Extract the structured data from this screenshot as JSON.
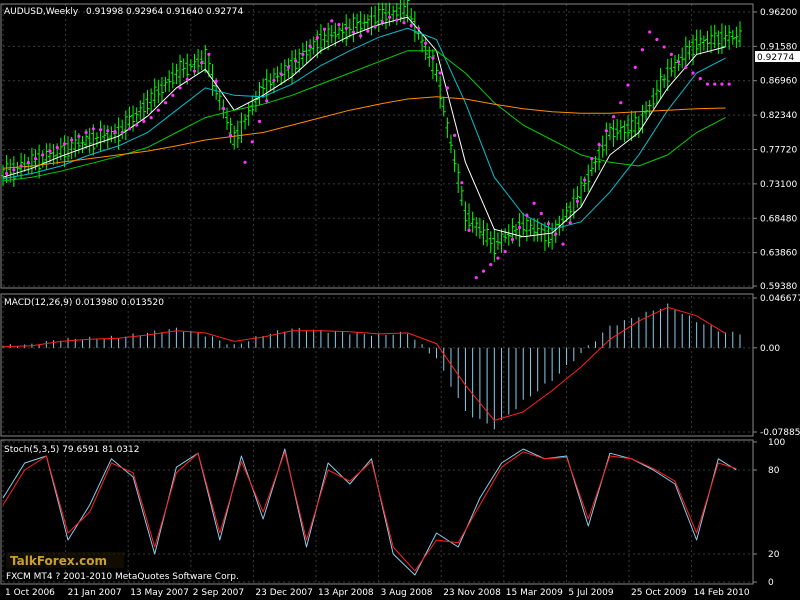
{
  "chart_data": [
    {
      "type": "line",
      "panel": "price",
      "title": "AUDUSD,Weekly",
      "ohlc_header": [
        "0.91998",
        "0.92964",
        "0.91640",
        "0.92774"
      ],
      "current_price": "0.92774",
      "ylim": [
        0.5938,
        0.97
      ],
      "y_ticks": [
        "0.96200",
        "0.91580",
        "0.86960",
        "0.82340",
        "0.77720",
        "0.73100",
        "0.68480",
        "0.63860",
        "0.59380"
      ],
      "x_ticks": [
        "1 Oct 2006",
        "21 Jan 2007",
        "13 May 2007",
        "2 Sep 2007",
        "23 Dec 2007",
        "13 Apr 2008",
        "3 Aug 2008",
        "23 Nov 2008",
        "15 Mar 2009",
        "5 Jul 2009",
        "25 Oct 2009",
        "14 Feb 2010"
      ],
      "grid": true,
      "x_index": [
        0,
        8,
        16,
        24,
        32,
        40,
        48,
        56,
        64,
        72,
        80,
        88,
        96,
        104,
        112,
        120,
        128,
        136,
        144,
        152,
        160,
        168,
        176,
        184,
        192,
        200
      ],
      "series": [
        {
          "role": "close",
          "color": "#00ff00",
          "values": [
            0.745,
            0.76,
            0.775,
            0.79,
            0.8,
            0.84,
            0.88,
            0.9,
            0.79,
            0.86,
            0.89,
            0.925,
            0.94,
            0.955,
            0.965,
            0.88,
            0.69,
            0.65,
            0.675,
            0.66,
            0.72,
            0.8,
            0.81,
            0.88,
            0.92,
            0.928
          ]
        },
        {
          "role": "fast-ma",
          "color": "#ffffff",
          "values": [
            0.74,
            0.752,
            0.768,
            0.782,
            0.795,
            0.822,
            0.86,
            0.885,
            0.83,
            0.85,
            0.875,
            0.91,
            0.93,
            0.945,
            0.955,
            0.91,
            0.76,
            0.67,
            0.66,
            0.665,
            0.7,
            0.77,
            0.8,
            0.86,
            0.905,
            0.915
          ]
        },
        {
          "role": "mid-ma",
          "color": "#00c0d0",
          "values": [
            0.738,
            0.745,
            0.755,
            0.77,
            0.782,
            0.8,
            0.83,
            0.86,
            0.85,
            0.848,
            0.865,
            0.89,
            0.91,
            0.928,
            0.94,
            0.925,
            0.84,
            0.74,
            0.69,
            0.67,
            0.68,
            0.72,
            0.77,
            0.83,
            0.88,
            0.9
          ]
        },
        {
          "role": "slow-ma",
          "color": "#00d000",
          "values": [
            0.735,
            0.74,
            0.748,
            0.758,
            0.768,
            0.78,
            0.8,
            0.82,
            0.83,
            0.838,
            0.85,
            0.865,
            0.88,
            0.895,
            0.91,
            0.91,
            0.88,
            0.84,
            0.81,
            0.79,
            0.77,
            0.76,
            0.755,
            0.77,
            0.8,
            0.82
          ]
        },
        {
          "role": "long-ma",
          "color": "#ff8c00",
          "values": [
            0.752,
            0.755,
            0.76,
            0.765,
            0.77,
            0.775,
            0.782,
            0.79,
            0.795,
            0.8,
            0.81,
            0.82,
            0.83,
            0.838,
            0.845,
            0.848,
            0.845,
            0.838,
            0.832,
            0.828,
            0.826,
            0.826,
            0.828,
            0.83,
            0.832,
            0.833
          ]
        }
      ],
      "psar": {
        "color": "#ff33ff",
        "x_index": [
          4,
          12,
          20,
          28,
          36,
          44,
          52,
          60,
          70,
          78,
          86,
          94,
          102,
          110,
          118,
          126,
          134,
          142,
          150,
          158,
          166,
          174,
          182,
          190,
          198
        ],
        "values": [
          0.745,
          0.765,
          0.785,
          0.805,
          0.8,
          0.82,
          0.86,
          0.905,
          0.76,
          0.87,
          0.905,
          0.95,
          0.93,
          0.955,
          0.94,
          0.86,
          0.605,
          0.64,
          0.705,
          0.65,
          0.765,
          0.84,
          0.935,
          0.895,
          0.865
        ]
      }
    },
    {
      "type": "bar",
      "panel": "macd",
      "title": "MACD(12,26,9) 0.013980 0.013520",
      "ylim": [
        -0.07885,
        0.04667
      ],
      "y_ticks": [
        "0.046677",
        "0.00",
        "-0.07885"
      ],
      "x_index": [
        0,
        8,
        16,
        24,
        32,
        40,
        48,
        56,
        64,
        72,
        80,
        88,
        96,
        104,
        112,
        120,
        128,
        136,
        144,
        152,
        160,
        168,
        176,
        184,
        192,
        200
      ],
      "series": [
        {
          "role": "histogram",
          "color": "#87ceeb",
          "values": [
            0.002,
            0.003,
            0.008,
            0.009,
            0.01,
            0.014,
            0.018,
            0.012,
            0.002,
            0.012,
            0.018,
            0.016,
            0.014,
            0.012,
            0.014,
            -0.01,
            -0.06,
            -0.075,
            -0.05,
            -0.03,
            -0.005,
            0.02,
            0.03,
            0.04,
            0.025,
            0.014
          ]
        },
        {
          "role": "signal",
          "color": "#ff2020",
          "values": [
            0.001,
            0.002,
            0.006,
            0.008,
            0.009,
            0.012,
            0.016,
            0.014,
            0.006,
            0.01,
            0.016,
            0.016,
            0.015,
            0.013,
            0.014,
            0.004,
            -0.035,
            -0.068,
            -0.06,
            -0.04,
            -0.018,
            0.008,
            0.025,
            0.038,
            0.03,
            0.0135
          ]
        }
      ]
    },
    {
      "type": "line",
      "panel": "stochastic",
      "title": "Stoch(5,3,5) 79.6591 81.0312",
      "ylim": [
        0,
        100
      ],
      "y_ticks": [
        "100",
        "80",
        "20",
        "0"
      ],
      "x_index": [
        0,
        6,
        12,
        18,
        24,
        30,
        36,
        42,
        48,
        54,
        60,
        66,
        72,
        78,
        84,
        90,
        96,
        102,
        108,
        114,
        120,
        126,
        132,
        138,
        144,
        150,
        156,
        162,
        168,
        174,
        180,
        186,
        192,
        198,
        203
      ],
      "series": [
        {
          "role": "%K",
          "color": "#87ceeb",
          "values": [
            60,
            85,
            90,
            30,
            55,
            88,
            75,
            20,
            82,
            92,
            30,
            90,
            45,
            95,
            25,
            85,
            70,
            88,
            20,
            5,
            35,
            25,
            60,
            85,
            95,
            88,
            90,
            40,
            92,
            88,
            80,
            70,
            30,
            88,
            80
          ]
        },
        {
          "role": "%D",
          "color": "#ff2020",
          "values": [
            55,
            80,
            90,
            35,
            50,
            85,
            78,
            25,
            78,
            92,
            35,
            86,
            50,
            93,
            30,
            80,
            72,
            86,
            25,
            8,
            30,
            28,
            55,
            82,
            93,
            88,
            89,
            45,
            90,
            88,
            81,
            72,
            35,
            85,
            81
          ]
        }
      ]
    }
  ],
  "watermark": {
    "text": "FXCM MT4 ? 2001-2010 MetaQuotes Software Corp.",
    "logo_text": "TalkForex.com"
  }
}
